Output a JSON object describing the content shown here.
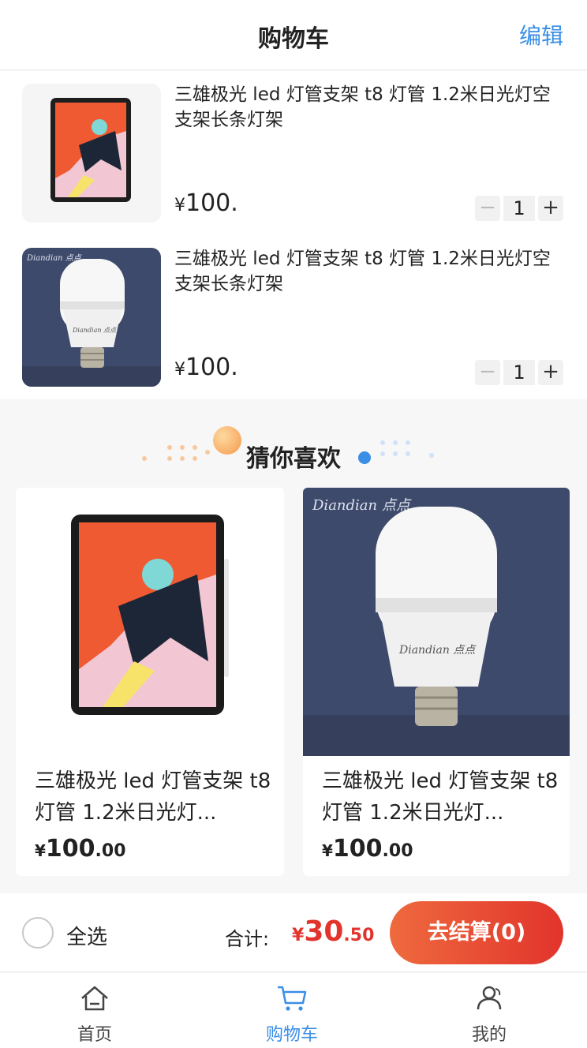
{
  "header": {
    "title": "购物车",
    "edit_label": "编辑"
  },
  "cart": {
    "items": [
      {
        "name": "三雄极光 led 灯管支架 t8 灯管 1.2米日光灯空支架长条灯架",
        "currency": "¥",
        "price": "100.",
        "quantity": "1",
        "image": "tablet"
      },
      {
        "name": "三雄极光 led 灯管支架 t8 灯管 1.2米日光灯空支架长条灯架",
        "currency": "¥",
        "price": "100.",
        "quantity": "1",
        "image": "bulb"
      }
    ],
    "minus_symbol": "−",
    "plus_symbol": "+"
  },
  "recommend": {
    "title": "猜你喜欢",
    "items": [
      {
        "name": "三雄极光 led 灯管支架 t8 灯管 1.2米日光灯...",
        "currency": "¥",
        "price_int": "100",
        "price_dec": ".00",
        "image": "tablet"
      },
      {
        "name": "三雄极光 led 灯管支架 t8 灯管 1.2米日光灯...",
        "currency": "¥",
        "price_int": "100",
        "price_dec": ".00",
        "image": "bulb"
      }
    ]
  },
  "bulb_brand": "Diandian 点点",
  "checkout": {
    "select_all_label": "全选",
    "total_label": "合计:",
    "currency": "¥",
    "total_int": "30",
    "total_dec": ".50",
    "pay_label": "去结算(0)"
  },
  "tabbar": {
    "tabs": [
      {
        "label": "首页",
        "icon": "home-icon",
        "active": false
      },
      {
        "label": "购物车",
        "icon": "cart-icon",
        "active": true
      },
      {
        "label": "我的",
        "icon": "user-icon",
        "active": false
      }
    ]
  },
  "colors": {
    "accent_blue": "#3a8ee6",
    "price_red": "#e2342c",
    "pay_gradient_start": "#ee6a3e",
    "bulb_bg": "#3d4a6b"
  }
}
